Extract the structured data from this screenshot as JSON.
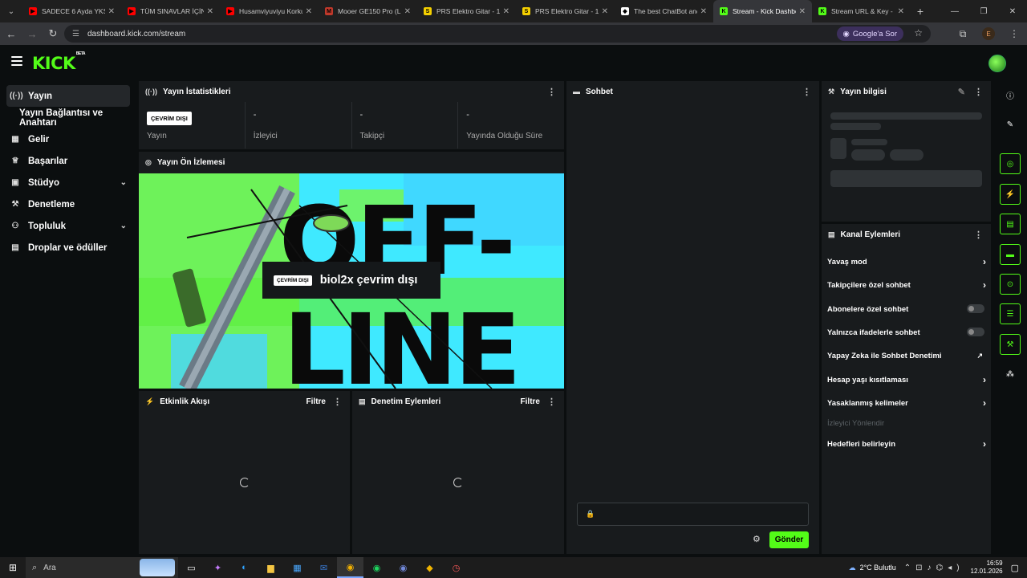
{
  "browser": {
    "tabs": [
      {
        "title": "SADECE 6 Ayda YKS'y",
        "fav_color": "#ff0000"
      },
      {
        "title": "TÜM SINAVLAR İÇİN",
        "fav_color": "#ff0000"
      },
      {
        "title": "Husamviyuviyu Korku",
        "fav_color": "#ff0000"
      },
      {
        "title": "Mooer GE150 Pro (LE",
        "fav_color": "#c0392b"
      },
      {
        "title": "PRS Elektro Gitar - 12",
        "fav_color": "#f5d000"
      },
      {
        "title": "PRS Elektro Gitar - 12",
        "fav_color": "#f5d000"
      },
      {
        "title": "The best ChatBot and",
        "fav_color": "#ffffff"
      },
      {
        "title": "Stream - Kick Dashbo",
        "fav_color": "#53fc18"
      },
      {
        "title": "Stream URL & Key - K",
        "fav_color": "#53fc18"
      }
    ],
    "fav_letters": [
      "▶",
      "▶",
      "▶",
      "M",
      "S",
      "S",
      "◆",
      "K",
      "K"
    ],
    "url": "dashboard.kick.com/stream",
    "google_ask": "Google'a Sor",
    "profile_letter": "E"
  },
  "app": {
    "logo": "KICK",
    "logo_badge": "BETA",
    "accent": "#53fc18"
  },
  "sidebar": {
    "items": [
      {
        "label": "Yayın",
        "icon": "broadcast-icon",
        "glyph": "((·))"
      },
      {
        "label": "Yayın Bağlantısı ve Anahtarı"
      },
      {
        "label": "Gelir",
        "icon": "chart-icon",
        "glyph": "▦"
      },
      {
        "label": "Başarılar",
        "icon": "trophy-icon",
        "glyph": "🏆"
      },
      {
        "label": "Stüdyo",
        "icon": "studio-icon",
        "glyph": "▣"
      },
      {
        "label": "Denetleme",
        "icon": "wrench-icon",
        "glyph": "🔧"
      },
      {
        "label": "Topluluk",
        "icon": "people-icon",
        "glyph": "👥"
      },
      {
        "label": "Droplar ve ödüller",
        "icon": "gift-icon",
        "glyph": "🎁"
      }
    ]
  },
  "stats": {
    "title": "Yayın İstatistikleri",
    "status_badge": "ÇEVRİM DIŞI",
    "status_label": "Yayın",
    "items": [
      {
        "value": "-",
        "label": "İzleyici"
      },
      {
        "value": "-",
        "label": "Takipçi"
      },
      {
        "value": "-",
        "label": "Yayında Olduğu Süre"
      }
    ]
  },
  "preview": {
    "title": "Yayın Ön İzlemesi",
    "banner_text_1": "OFF-",
    "banner_text_2": "LINE",
    "badge": "ÇEVRİM DIŞI",
    "offline_text": "biol2x çevrim dışı"
  },
  "activity": {
    "title": "Etkinlik Akışı",
    "filter": "Filtre"
  },
  "moderation": {
    "title": "Denetim Eylemleri",
    "filter": "Filtre"
  },
  "chat": {
    "title": "Sohbet",
    "send": "Gönder"
  },
  "stream_info": {
    "title": "Yayın bilgisi"
  },
  "channel_actions": {
    "title": "Kanal Eylemleri",
    "items": [
      {
        "label": "Yavaş mod",
        "control": "arrow"
      },
      {
        "label": "Takipçilere özel sohbet",
        "control": "arrow"
      },
      {
        "label": "Abonelere özel sohbet",
        "control": "toggle"
      },
      {
        "label": "Yalnızca ifadelerle sohbet",
        "control": "toggle"
      },
      {
        "label": "Yapay Zeka ile Sohbet Denetimi",
        "control": "external"
      },
      {
        "label": "Hesap yaşı kısıtlaması",
        "control": "arrow"
      },
      {
        "label": "Yasaklanmış kelimeler",
        "control": "arrow"
      },
      {
        "label": "İzleyici Yönlendir",
        "control": "none"
      },
      {
        "label": "Hedefleri belirleyin",
        "control": "arrow"
      }
    ]
  },
  "taskbar": {
    "search": "Ara",
    "weather": "2°C  Bulutlu",
    "time": "16:59",
    "date": "12.01.2026"
  }
}
